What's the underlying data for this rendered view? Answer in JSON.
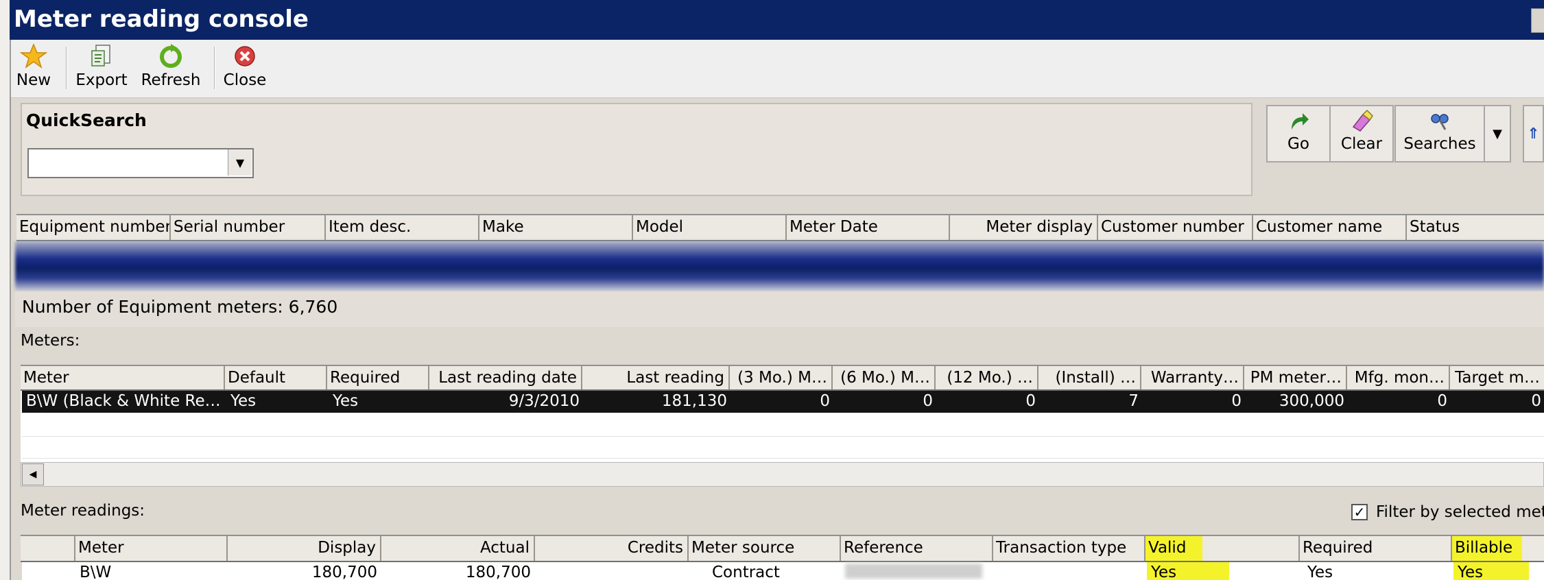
{
  "window": {
    "title": "Meter reading console"
  },
  "toolbar": {
    "buttons": [
      {
        "label": "New",
        "icon": "star-icon"
      },
      {
        "label": "Export",
        "icon": "export-icon"
      },
      {
        "label": "Refresh",
        "icon": "refresh-icon"
      },
      {
        "label": "Close",
        "icon": "close-icon"
      }
    ]
  },
  "quicksearch": {
    "title": "QuickSearch",
    "value": "",
    "buttons": [
      {
        "label": "Go",
        "icon": "go-arrow-icon"
      },
      {
        "label": "Clear",
        "icon": "eraser-icon"
      },
      {
        "label": "Searches",
        "icon": "binoculars-icon"
      }
    ]
  },
  "equipment_grid": {
    "columns": [
      "Equipment number",
      "Serial number",
      "Item desc.",
      "Make",
      "Model",
      "Meter Date",
      "Meter display",
      "Customer number",
      "Customer name",
      "Status"
    ]
  },
  "equipment_count": "Number of Equipment meters: 6,760",
  "meters": {
    "label": "Meters:",
    "columns": [
      "Meter",
      "Default",
      "Required",
      "Last reading date",
      "Last reading",
      "(3 Mo.) M…",
      "(6 Mo.) M…",
      "(12 Mo.) …",
      "(Install) …",
      "Warranty…",
      "PM meter…",
      "Mfg. mon…",
      "Target m…"
    ],
    "rows": [
      [
        "B\\W (Black & White Re…",
        "Yes",
        "Yes",
        "9/3/2010",
        "181,130",
        "0",
        "0",
        "0",
        "7",
        "0",
        "300,000",
        "0",
        "0"
      ]
    ]
  },
  "meter_readings": {
    "label": "Meter readings:",
    "filter_label": "Filter by selected met",
    "filter_checked": true,
    "columns": [
      "Meter",
      "Display",
      "Actual",
      "Credits",
      "Meter source",
      "Reference",
      "Transaction type",
      "Valid",
      "Required",
      "Billable"
    ],
    "highlight_color": "#f4f32b",
    "rows": [
      [
        "B\\W",
        "180,700",
        "180,700",
        "",
        "Contract",
        "",
        "",
        "Yes",
        "Yes",
        "Yes"
      ]
    ]
  },
  "colors": {
    "titlebar": "#0b2466",
    "selected_row": "#141414"
  }
}
